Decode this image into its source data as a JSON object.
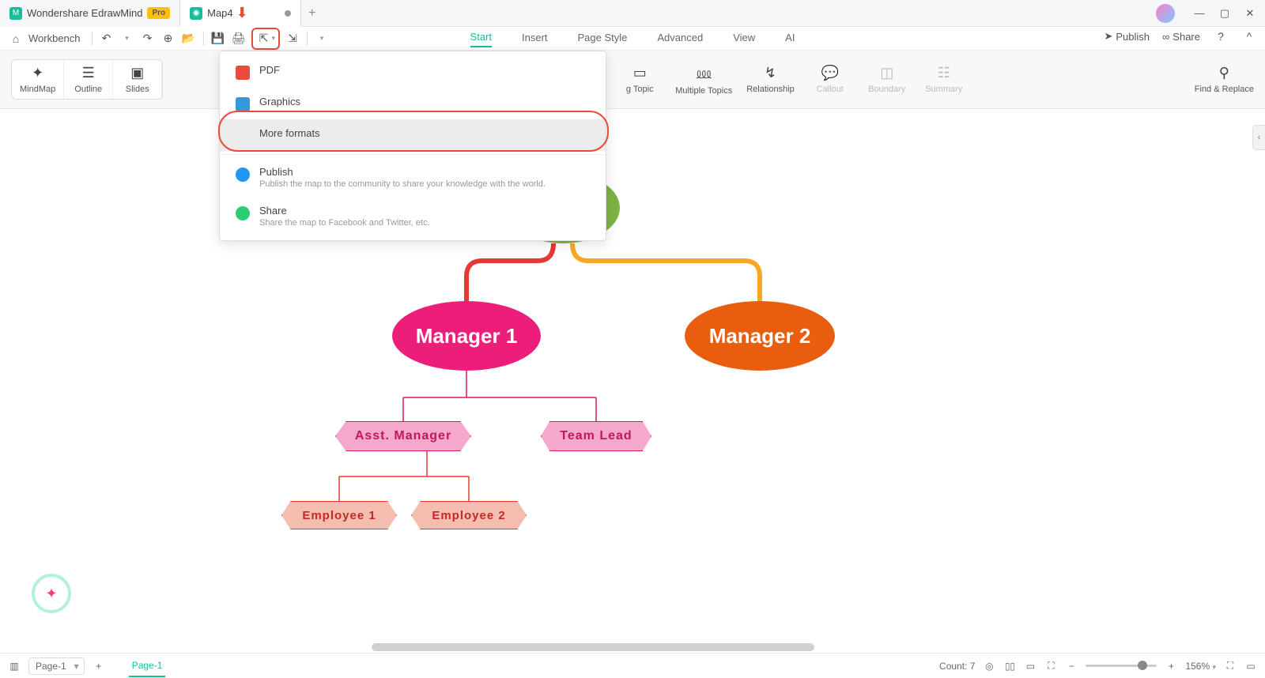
{
  "title_bar": {
    "app_tab": "Wondershare EdrawMind",
    "pro_badge": "Pro",
    "doc_tab": "Map4"
  },
  "toolbar": {
    "workbench": "Workbench"
  },
  "menu": {
    "items": [
      "Start",
      "Insert",
      "Page Style",
      "Advanced",
      "View",
      "AI"
    ],
    "publish": "Publish",
    "share": "Share"
  },
  "ribbon": {
    "views": [
      "MindMap",
      "Outline",
      "Slides"
    ],
    "floating_topic": "g Topic",
    "multiple_topics": "Multiple Topics",
    "relationship": "Relationship",
    "callout": "Callout",
    "boundary": "Boundary",
    "summary": "Summary",
    "find_replace": "Find & Replace"
  },
  "dropdown": {
    "pdf": "PDF",
    "graphics": "Graphics",
    "more_formats": "More formats",
    "publish": "Publish",
    "publish_sub": "Publish the map to the community to share your knowledge with the world.",
    "share": "Share",
    "share_sub": "Share the map to Facebook and Twitter, etc."
  },
  "nodes": {
    "manager1": "Manager 1",
    "manager2": "Manager 2",
    "asst_manager": "Asst. Manager",
    "team_lead": "Team Lead",
    "employee1": "Employee 1",
    "employee2": "Employee 2"
  },
  "status": {
    "page_select": "Page-1",
    "page_tab": "Page-1",
    "count": "Count: 7",
    "zoom": "156%"
  }
}
